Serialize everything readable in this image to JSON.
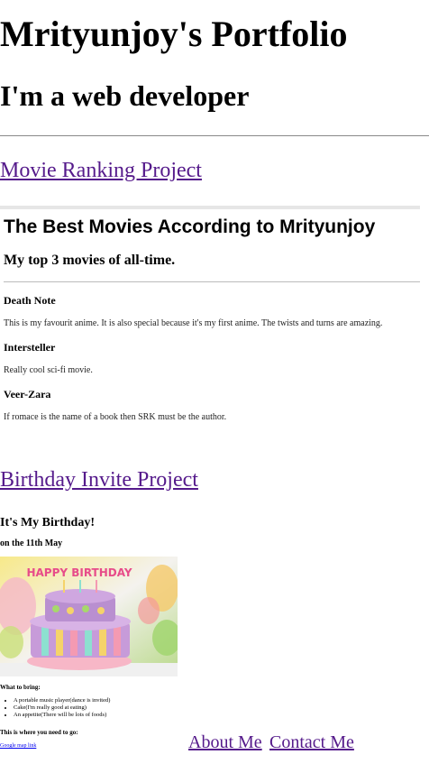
{
  "header": {
    "title": "Mrityunjoy's Portfolio",
    "subtitle": "I'm a web developer"
  },
  "projects": {
    "movie_link": "Movie Ranking Project",
    "birthday_link": "Birthday Invite Project"
  },
  "movie_page": {
    "title": "The Best Movies According to Mrityunjoy",
    "subtitle": "My top 3 movies of all-time.",
    "movies": [
      {
        "name": "Death Note",
        "desc": "This is my favourit anime. It is also special because it's my first anime. The twists and turns are amazing."
      },
      {
        "name": "Intersteller",
        "desc": "Really cool sci-fi movie."
      },
      {
        "name": "Veer-Zara",
        "desc": "If romace is the name of a book then SRK must be the author."
      }
    ]
  },
  "birthday_page": {
    "title": "It's My Birthday!",
    "date": "on the 11th May",
    "cake_text": "HAPPY BIRTHDAY",
    "bring_heading": "What to bring:",
    "bring_items": [
      "A portable music player(dance is invited)",
      "Cake(I'm really good at eating)",
      "An appetite(There will be lots of foods)"
    ],
    "where_heading": "This is where you need to go:",
    "map_link": "Google map link"
  },
  "footer": {
    "about": "About Me",
    "contact": "Contact Me"
  }
}
